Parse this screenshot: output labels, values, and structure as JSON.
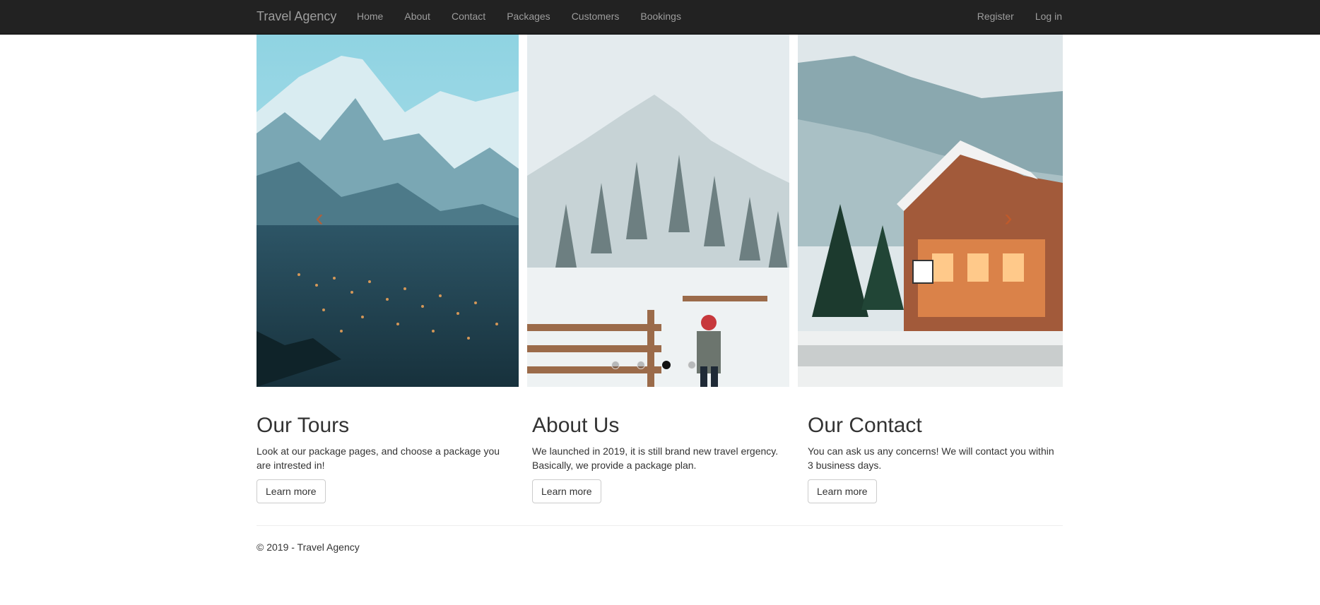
{
  "navbar": {
    "brand": "Travel Agency",
    "links": [
      "Home",
      "About",
      "Contact",
      "Packages",
      "Customers",
      "Bookings"
    ],
    "right_links": [
      "Register",
      "Log in"
    ]
  },
  "carousel": {
    "prev_icon": "chevron-left-icon",
    "next_icon": "chevron-right-icon",
    "prev_glyph": "‹",
    "next_glyph": "›",
    "indicator_count": 4,
    "active_indicator": 2
  },
  "sections": [
    {
      "title": "Our Tours",
      "text": "Look at our package pages, and choose a package you are intrested in!",
      "button": "Learn more"
    },
    {
      "title": "About Us",
      "text": "We launched in 2019, it is still brand new travel ergency. Basically, we provide a package plan.",
      "button": "Learn more"
    },
    {
      "title": "Our Contact",
      "text": "You can ask us any concerns! We will contact you within 3 business days.",
      "button": "Learn more"
    }
  ],
  "footer": {
    "text": "© 2019 - Travel Agency"
  },
  "colors": {
    "navbar_bg": "#222222",
    "nav_text": "#9d9d9d",
    "body_text": "#333333"
  }
}
